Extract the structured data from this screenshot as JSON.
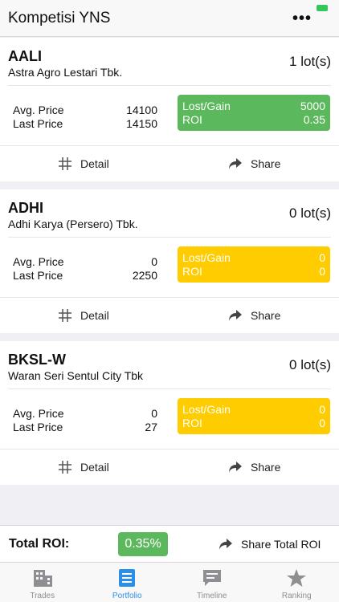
{
  "header": {
    "title": "Kompetisi YNS",
    "menu_icon": "more-icon"
  },
  "labels": {
    "avg_price": "Avg. Price",
    "last_price": "Last Price",
    "lost_gain": "Lost/Gain",
    "roi": "ROI",
    "detail": "Detail",
    "share": "Share"
  },
  "colors": {
    "green": "#5cb85c",
    "yellow": "#ffcc00",
    "accent": "#2b8fe8"
  },
  "holdings": [
    {
      "ticker": "AALI",
      "company": "Astra Agro Lestari Tbk.",
      "lots": "1 lot(s)",
      "avg_price": "14100",
      "last_price": "14150",
      "lost_gain": "5000",
      "roi": "0.35",
      "status": "green"
    },
    {
      "ticker": "ADHI",
      "company": "Adhi Karya (Persero) Tbk.",
      "lots": "0 lot(s)",
      "avg_price": "0",
      "last_price": "2250",
      "lost_gain": "0",
      "roi": "0",
      "status": "yellow"
    },
    {
      "ticker": "BKSL-W",
      "company": "Waran Seri Sentul City Tbk",
      "lots": "0 lot(s)",
      "avg_price": "0",
      "last_price": "27",
      "lost_gain": "0",
      "roi": "0",
      "status": "yellow"
    }
  ],
  "footer": {
    "total_label": "Total ROI:",
    "total_value": "0.35%",
    "share_total": "Share Total ROI"
  },
  "tabs": [
    {
      "label": "Trades",
      "icon": "building-icon"
    },
    {
      "label": "Portfolio",
      "icon": "portfolio-icon",
      "active": true
    },
    {
      "label": "Timeline",
      "icon": "chat-icon"
    },
    {
      "label": "Ranking",
      "icon": "star-icon"
    }
  ]
}
